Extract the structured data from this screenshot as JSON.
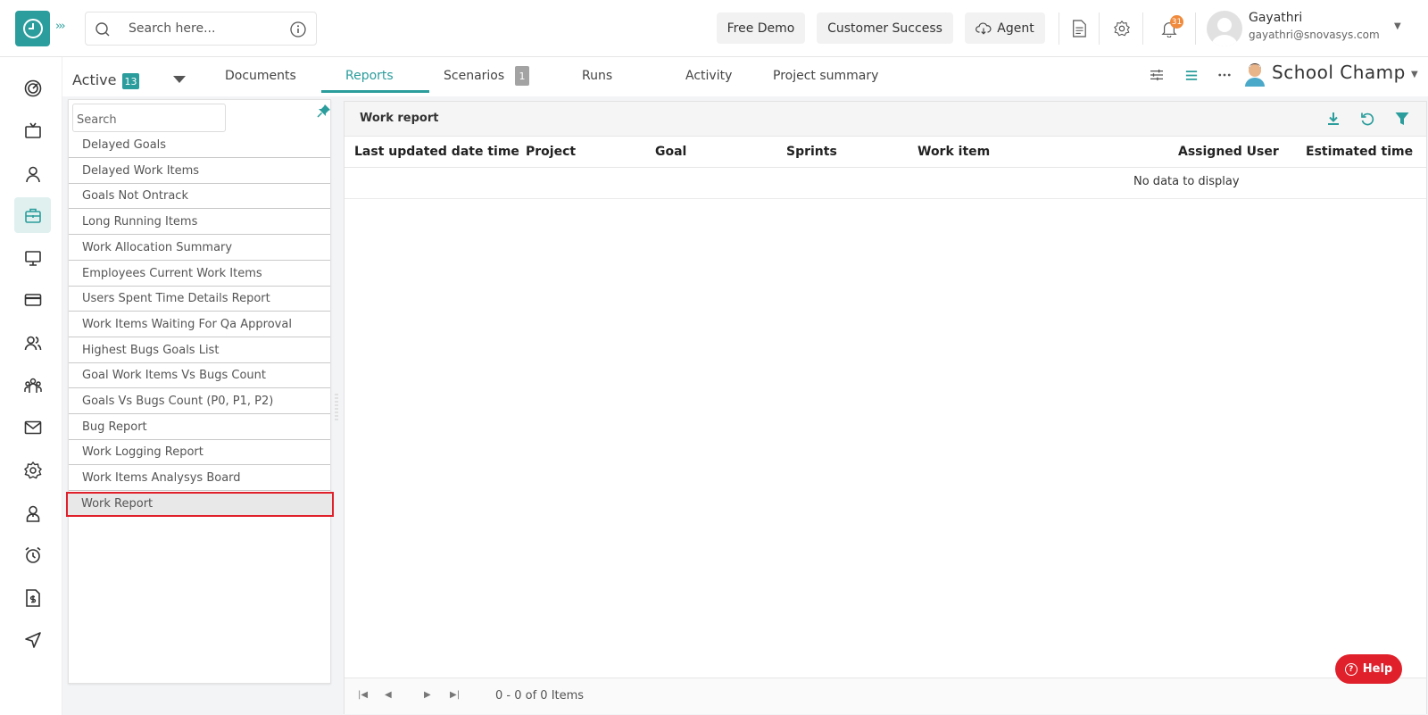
{
  "header": {
    "search_placeholder": "Search here...",
    "free_demo": "Free Demo",
    "customer_success": "Customer Success",
    "agent": "Agent",
    "notification_count": "31",
    "user_name": "Gayathri",
    "user_email": "gayathri@snovasys.com"
  },
  "tabs": {
    "active_label": "Active",
    "active_count": "13",
    "items": [
      "Documents",
      "Reports",
      "Scenarios",
      "Runs",
      "Activity",
      "Project summary"
    ],
    "selected": "Reports",
    "scenarios_count": "1",
    "project_name": "School Champ"
  },
  "reports": {
    "search_placeholder": "Search",
    "items": [
      "Delayed Goals",
      "Delayed Work Items",
      "Goals Not Ontrack",
      "Long Running Items",
      "Work Allocation Summary",
      "Employees Current Work Items",
      "Users Spent Time Details Report",
      "Work Items Waiting For Qa Approval",
      "Highest Bugs Goals List",
      "Goal Work Items Vs Bugs Count",
      "Goals Vs Bugs Count (P0, P1, P2)",
      "Bug Report",
      "Work Logging Report",
      "Work Items Analysys Board",
      "Work Report"
    ],
    "selected": "Work Report"
  },
  "work_report": {
    "title": "Work report",
    "columns": [
      "Last updated date time",
      "Project",
      "Goal",
      "Sprints",
      "Work item",
      "Assigned User",
      "Estimated time"
    ],
    "empty_text": "No data to display",
    "pager_info": "0 - 0 of 0 Items"
  },
  "help": {
    "label": "Help"
  },
  "colors": {
    "accent": "#2a9d9c",
    "danger": "#e0202a",
    "notification": "#f08a3c"
  }
}
